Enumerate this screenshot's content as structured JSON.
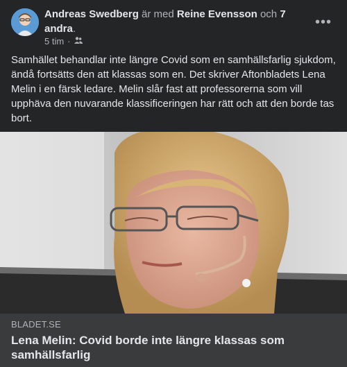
{
  "post": {
    "author": "Andreas Swedberg",
    "with_text": "är med",
    "tagged_person": "Reine Evensson",
    "and_text": "och",
    "others": "7 andra",
    "period": ".",
    "time": "5 tim",
    "separator": "·",
    "audience_icon": "friends-icon",
    "more_icon": "more-options-icon",
    "more_label": "•••",
    "text": "Samhället behandlar inte längre Covid som en samhällsfarlig sjukdom, ändå fortsätts den att klassas som en. Det skriver Aftonbladets Lena Melin i en färsk ledare. Melin slår fast att professorerna som vill upphäva den nuvarande klassificeringen har rätt och att den borde tas bort."
  },
  "link_preview": {
    "domain": "BLADET.SE",
    "title": "Lena Melin: Covid borde inte längre klassas som samhällsfarlig"
  },
  "colors": {
    "background": "#242526",
    "link_box": "#3a3b3c",
    "primary_text": "#e4e6eb",
    "secondary_text": "#b0b3b8"
  }
}
